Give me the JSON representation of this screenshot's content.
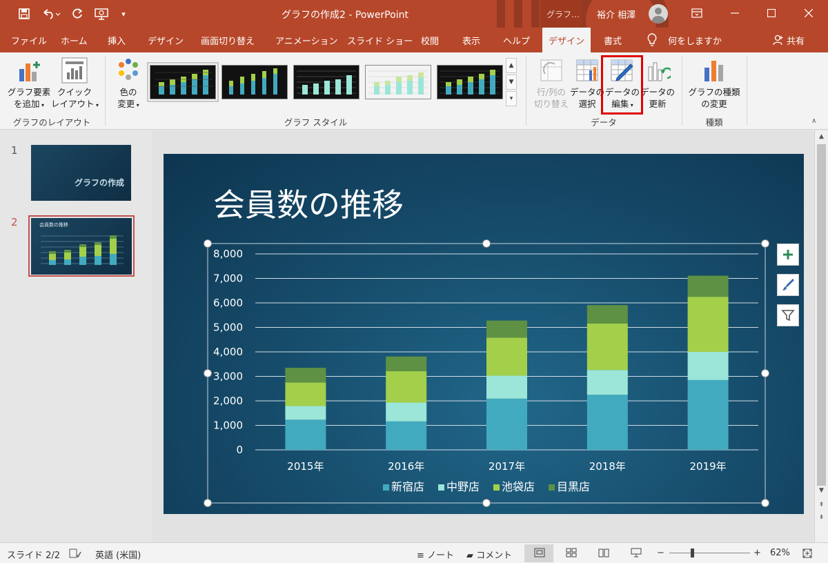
{
  "titlebar": {
    "title": "グラフの作成2 - PowerPoint",
    "context_tab": "グラフ…",
    "user": "裕介 相澤",
    "quick_access": {
      "customize": "▾"
    }
  },
  "tabs": [
    {
      "label": "ファイル"
    },
    {
      "label": "ホーム"
    },
    {
      "label": "挿入"
    },
    {
      "label": "デザイン"
    },
    {
      "label": "画面切り替え"
    },
    {
      "label": "アニメーション"
    },
    {
      "label": "スライド ショー"
    },
    {
      "label": "校閲"
    },
    {
      "label": "表示"
    },
    {
      "label": "ヘルプ"
    },
    {
      "label": "デザイン",
      "active": true
    },
    {
      "label": "書式"
    }
  ],
  "tell_me": "何をしますか",
  "share": "共有",
  "ribbon": {
    "layout": {
      "add_element_line1": "グラフ要素",
      "add_element_line2": "を追加",
      "quick_layout_line1": "クイック",
      "quick_layout_line2": "レイアウト",
      "group": "グラフのレイアウト"
    },
    "styles": {
      "change_colors_line1": "色の",
      "change_colors_line2": "変更",
      "group": "グラフ スタイル"
    },
    "data": {
      "switch_line1": "行/列の",
      "switch_line2": "切り替え",
      "select_line1": "データの",
      "select_line2": "選択",
      "edit_line1": "データの",
      "edit_line2": "編集",
      "refresh_line1": "データの",
      "refresh_line2": "更新",
      "group": "データ"
    },
    "type": {
      "change_type_line1": "グラフの種類",
      "change_type_line2": "の変更",
      "group": "種類"
    }
  },
  "slides": [
    {
      "num": "1",
      "thumb_title": "グラフの作成"
    },
    {
      "num": "2",
      "thumb_title": "会員数の推移",
      "active": true
    }
  ],
  "slide": {
    "title": "会員数の推移"
  },
  "chart_data": {
    "type": "bar",
    "stacked": true,
    "categories": [
      "2015年",
      "2016年",
      "2017年",
      "2018年",
      "2019年"
    ],
    "series": [
      {
        "name": "新宿店",
        "values": [
          1230,
          1160,
          2090,
          2250,
          2850
        ],
        "color": "#42aabf"
      },
      {
        "name": "中野店",
        "values": [
          560,
          770,
          940,
          1010,
          1150
        ],
        "color": "#9be6d8"
      },
      {
        "name": "池袋店",
        "values": [
          960,
          1280,
          1550,
          1900,
          2250
        ],
        "color": "#a3cf4a"
      },
      {
        "name": "目黒店",
        "values": [
          600,
          600,
          700,
          750,
          860
        ],
        "color": "#5e9144"
      }
    ],
    "ylim": [
      0,
      8000
    ],
    "yticks": [
      "0",
      "1,000",
      "2,000",
      "3,000",
      "4,000",
      "5,000",
      "6,000",
      "7,000",
      "8,000"
    ],
    "grid": true,
    "legend": "bottom",
    "title": "",
    "xlabel": "",
    "ylabel": ""
  },
  "status": {
    "slide": "スライド 2/2",
    "language": "英語 (米国)",
    "notes": "ノート",
    "comments": "コメント",
    "zoom": "62%",
    "zoom_minus": "−",
    "zoom_plus": "+"
  },
  "colors": {
    "accent": "#b7472a",
    "highlight_box": "#e00000"
  }
}
